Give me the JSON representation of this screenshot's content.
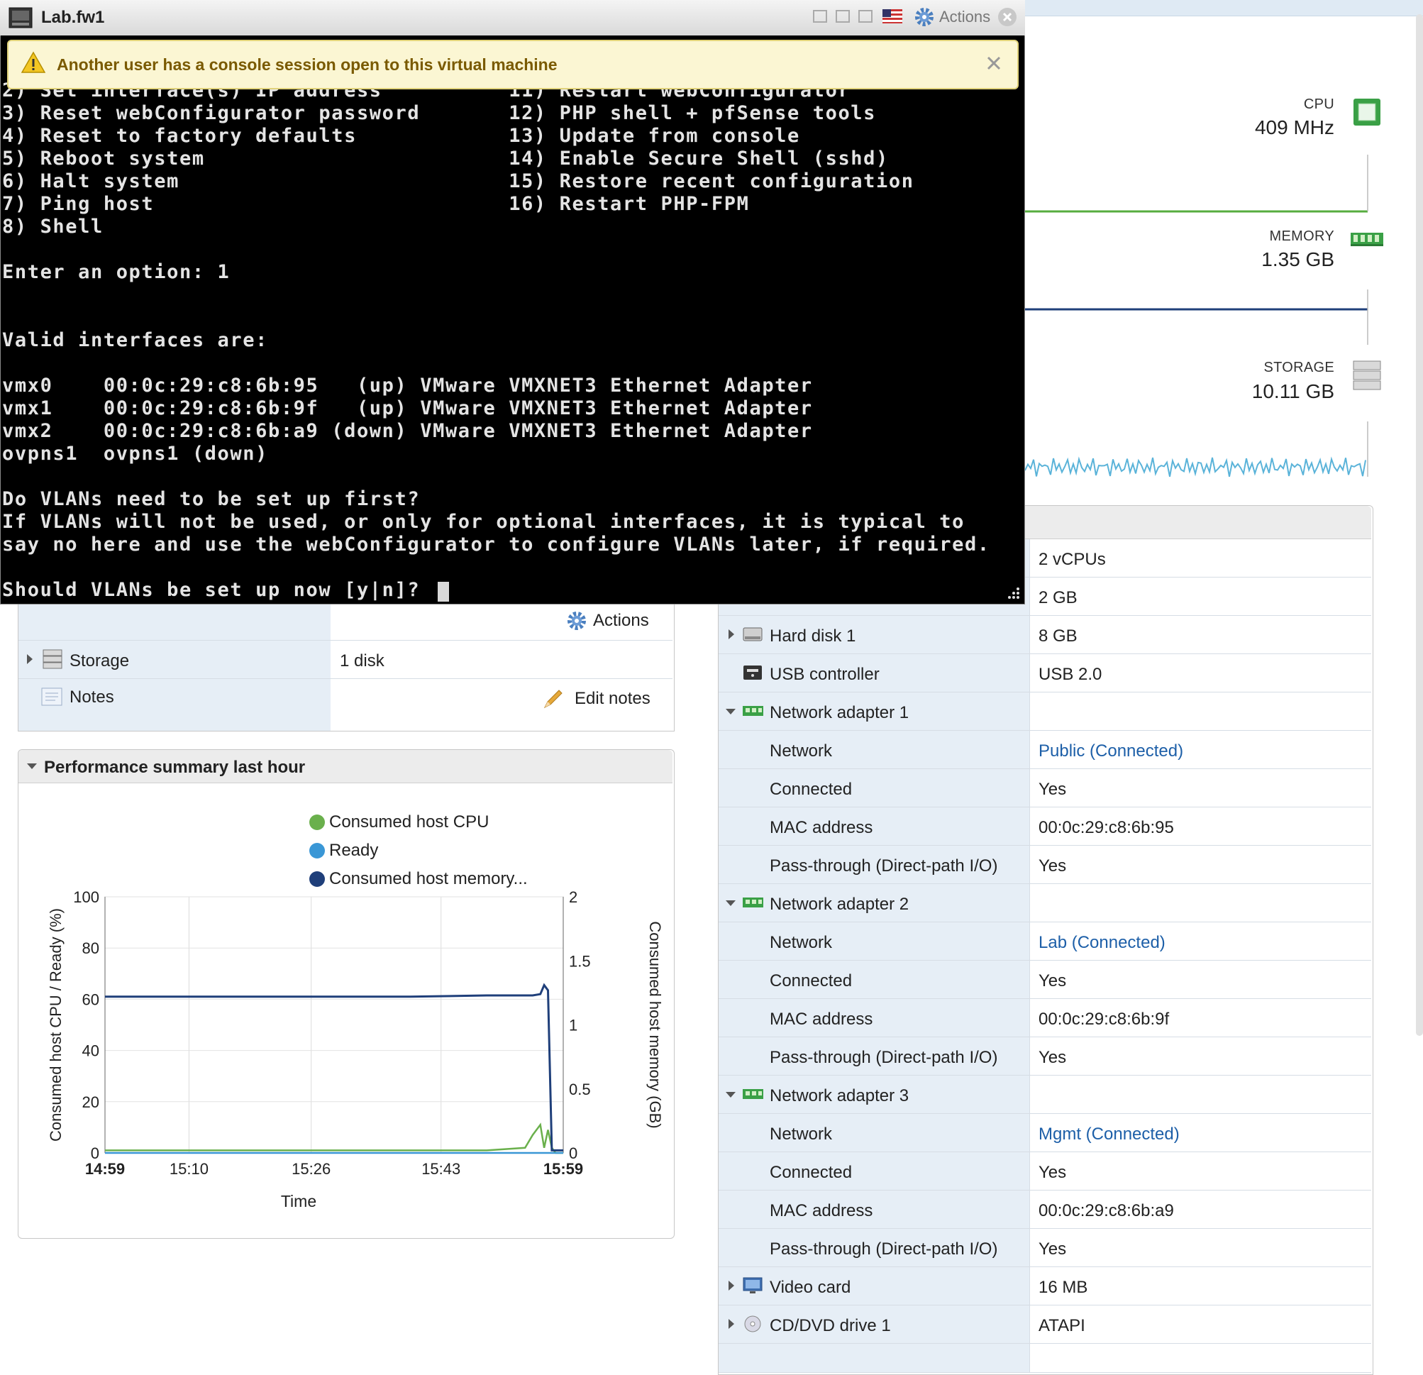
{
  "console": {
    "title": "Lab.fw1",
    "actions_label": "Actions",
    "warning": "Another user has a console session open to this virtual machine",
    "terminal_lines": [
      "2) Set interface(s) IP address          11) Restart webConfigurator",
      "3) Reset webConfigurator password       12) PHP shell + pfSense tools",
      "4) Reset to factory defaults            13) Update from console",
      "5) Reboot system                        14) Enable Secure Shell (sshd)",
      "6) Halt system                          15) Restore recent configuration",
      "7) Ping host                            16) Restart PHP-FPM",
      "8) Shell",
      "",
      "Enter an option: 1",
      "",
      "",
      "Valid interfaces are:",
      "",
      "vmx0    00:0c:29:c8:6b:95   (up) VMware VMXNET3 Ethernet Adapter",
      "vmx1    00:0c:29:c8:6b:9f   (up) VMware VMXNET3 Ethernet Adapter",
      "vmx2    00:0c:29:c8:6b:a9 (down) VMware VMXNET3 Ethernet Adapter",
      "ovpns1  ovpns1 (down)",
      "",
      "Do VLANs need to be set up first?",
      "If VLANs will not be used, or only for optional interfaces, it is typical to",
      "say no here and use the webConfigurator to configure VLANs later, if required.",
      "",
      "Should VLANs be set up now [y|n]? "
    ]
  },
  "stats": {
    "cpu_label": "CPU",
    "cpu_value": "409 MHz",
    "memory_label": "MEMORY",
    "memory_value": "1.35 GB",
    "storage_label": "STORAGE",
    "storage_value": "10.11 GB"
  },
  "hardware": {
    "rows": [
      {
        "name": "",
        "value": "2 vCPUs",
        "icon": "cpu-icon",
        "toggle": "collapsed",
        "indent": false
      },
      {
        "name": "",
        "value": "2 GB",
        "icon": "memory-icon",
        "toggle": "collapsed",
        "indent": false
      },
      {
        "name": "Hard disk 1",
        "value": "8 GB",
        "icon": "hard-disk-icon",
        "toggle": "collapsed",
        "indent": false
      },
      {
        "name": "USB controller",
        "value": "USB 2.0",
        "icon": "usb-icon",
        "toggle": "none",
        "indent": false
      },
      {
        "name": "Network adapter 1",
        "value": "",
        "icon": "network-adapter-icon",
        "toggle": "expanded",
        "indent": false
      },
      {
        "name": "Network",
        "value": "Public (Connected)",
        "link": true,
        "indent": true
      },
      {
        "name": "Connected",
        "value": "Yes",
        "indent": true
      },
      {
        "name": "MAC address",
        "value": "00:0c:29:c8:6b:95",
        "indent": true
      },
      {
        "name": "Pass-through (Direct-path I/O)",
        "value": "Yes",
        "indent": true
      },
      {
        "name": "Network adapter 2",
        "value": "",
        "icon": "network-adapter-icon",
        "toggle": "expanded",
        "indent": false
      },
      {
        "name": "Network",
        "value": "Lab (Connected)",
        "link": true,
        "indent": true
      },
      {
        "name": "Connected",
        "value": "Yes",
        "indent": true
      },
      {
        "name": "MAC address",
        "value": "00:0c:29:c8:6b:9f",
        "indent": true
      },
      {
        "name": "Pass-through (Direct-path I/O)",
        "value": "Yes",
        "indent": true
      },
      {
        "name": "Network adapter 3",
        "value": "",
        "icon": "network-adapter-icon",
        "toggle": "expanded",
        "indent": false
      },
      {
        "name": "Network",
        "value": "Mgmt (Connected)",
        "link": true,
        "indent": true
      },
      {
        "name": "Connected",
        "value": "Yes",
        "indent": true
      },
      {
        "name": "MAC address",
        "value": "00:0c:29:c8:6b:a9",
        "indent": true
      },
      {
        "name": "Pass-through (Direct-path I/O)",
        "value": "Yes",
        "indent": true
      },
      {
        "name": "Video card",
        "value": "16 MB",
        "icon": "video-card-icon",
        "toggle": "collapsed",
        "indent": false
      },
      {
        "name": "CD/DVD drive 1",
        "value": "ATAPI",
        "icon": "cd-dvd-icon",
        "toggle": "collapsed",
        "indent": false
      }
    ]
  },
  "summary": {
    "actions_label": "Actions",
    "storage_label": "Storage",
    "storage_value": "1 disk",
    "notes_label": "Notes",
    "edit_notes_label": "Edit notes"
  },
  "performance": {
    "title": "Performance summary last hour",
    "legend": [
      "Consumed host CPU",
      "Ready",
      "Consumed host memory..."
    ],
    "colors": {
      "cpu": "#6ab04c",
      "ready": "#3a97d6",
      "memory": "#1f3f7a"
    }
  },
  "chart_data": {
    "type": "line",
    "title": "",
    "xlabel": "Time",
    "ylabel": "Consumed host CPU / Ready (%)",
    "y2label": "Consumed host memory (GB)",
    "x_ticks": [
      "14:59",
      "15:10",
      "15:26",
      "15:43",
      "15:59"
    ],
    "y_ticks": [
      "0",
      "20",
      "40",
      "60",
      "80",
      "100"
    ],
    "y2_ticks": [
      "0",
      "0.5",
      "1",
      "1.5",
      "2"
    ],
    "ylim": [
      0,
      100
    ],
    "y2lim": [
      0,
      2
    ],
    "x_minutes": [
      0,
      11,
      27,
      44,
      60
    ],
    "series": [
      {
        "name": "Consumed host CPU",
        "axis": "left",
        "x": [
          0,
          10,
          20,
          30,
          40,
          50,
          55,
          56,
          57,
          57.5,
          58,
          58.5,
          59,
          60
        ],
        "y": [
          1,
          1,
          1,
          1,
          1,
          1,
          2,
          7,
          11,
          2,
          9,
          2,
          0,
          0
        ]
      },
      {
        "name": "Ready",
        "axis": "left",
        "x": [
          0,
          60
        ],
        "y": [
          0,
          0
        ]
      },
      {
        "name": "Consumed host memory...",
        "axis": "right",
        "x": [
          0,
          10,
          20,
          30,
          40,
          50,
          56,
          57,
          57.5,
          58,
          58.5,
          59,
          60
        ],
        "y": [
          1.22,
          1.22,
          1.22,
          1.22,
          1.22,
          1.23,
          1.23,
          1.24,
          1.31,
          1.27,
          0.02,
          0.02,
          0.02
        ]
      }
    ]
  }
}
